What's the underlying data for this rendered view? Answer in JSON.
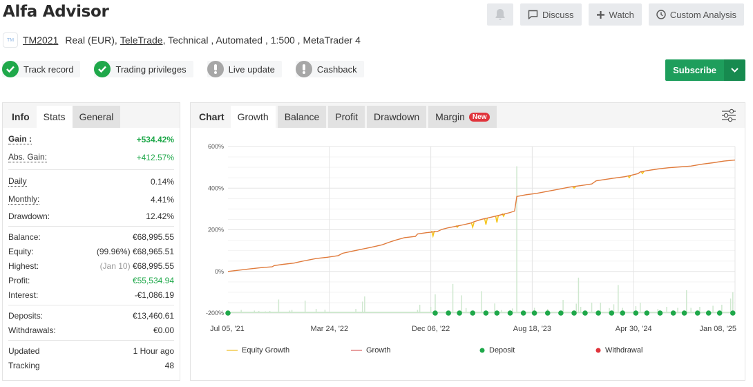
{
  "header": {
    "title": "Alfa Advisor",
    "actions": {
      "discuss": "Discuss",
      "watch": "Watch",
      "custom_analysis": "Custom Analysis"
    }
  },
  "account": {
    "logo_text": "TM",
    "name": "TM2021",
    "type": "Real (EUR),",
    "broker": "TeleTrade",
    "details": ", Technical , Automated , 1:500 , MetaTrader 4"
  },
  "badges": [
    {
      "label": "Track record",
      "status": "ok"
    },
    {
      "label": "Trading privileges",
      "status": "ok"
    },
    {
      "label": "Live update",
      "status": "warning"
    },
    {
      "label": "Cashback",
      "status": "warning"
    }
  ],
  "subscribe": {
    "label": "Subscribe"
  },
  "left_panel": {
    "tabs": [
      "Info",
      "Stats",
      "General"
    ],
    "stats": {
      "gain": {
        "label": "Gain :",
        "value": "+534.42%"
      },
      "abs_gain": {
        "label": "Abs. Gain:",
        "value": "+412.57%"
      },
      "daily": {
        "label": "Daily",
        "value": "0.14%"
      },
      "monthly": {
        "label": "Monthly:",
        "value": "4.41%"
      },
      "drawdown": {
        "label": "Drawdown:",
        "value": "12.42%"
      },
      "balance": {
        "label": "Balance:",
        "value": "€68,995.55"
      },
      "equity": {
        "label": "Equity:",
        "note": "(99.96%)",
        "value": "€68,965.51"
      },
      "highest": {
        "label": "Highest:",
        "note": "(Jan 10)",
        "value": "€68,995.55"
      },
      "profit": {
        "label": "Profit:",
        "value": "€55,534.94"
      },
      "interest": {
        "label": "Interest:",
        "value": "-€1,086.19"
      },
      "deposits": {
        "label": "Deposits:",
        "value": "€13,460.61"
      },
      "withdrawals": {
        "label": "Withdrawals:",
        "value": "€0.00"
      },
      "updated": {
        "label": "Updated",
        "value": "1 Hour ago"
      },
      "tracking": {
        "label": "Tracking",
        "value": "48"
      }
    }
  },
  "chart_panel": {
    "tabs": [
      "Chart",
      "Growth",
      "Balance",
      "Profit",
      "Drawdown",
      "Margin"
    ],
    "new_badge": "New"
  },
  "colors": {
    "growth": "#e07b3c",
    "equity_growth": "#f5c518",
    "deposit": "#1fa84a",
    "withdrawal": "#e0343c",
    "volume_bars": "#cfe8cf"
  },
  "chart_data": {
    "type": "line",
    "title": "",
    "xlabel": "",
    "ylabel": "",
    "ylim": [
      -200,
      600
    ],
    "yticks": [
      "600%",
      "400%",
      "200%",
      "0%",
      "-200%"
    ],
    "ytick_values": [
      600,
      400,
      200,
      0,
      -200
    ],
    "xticks": [
      "Jul 05, '21",
      "Mar 24, '22",
      "Dec 06, '22",
      "Aug 18, '23",
      "Apr 30, '24",
      "Jan 08, '25"
    ],
    "x_range": [
      0,
      1
    ],
    "grid": true,
    "legend_position": "bottom",
    "legend": [
      "Equity Growth",
      "Growth",
      "Deposit",
      "Withdrawal"
    ],
    "series": [
      {
        "name": "Growth",
        "points": [
          [
            0,
            0
          ],
          [
            0.05,
            6
          ],
          [
            0.1,
            12
          ],
          [
            0.15,
            18
          ],
          [
            0.2,
            22
          ],
          [
            0.21,
            28
          ],
          [
            0.25,
            34
          ],
          [
            0.3,
            40
          ],
          [
            0.32,
            45
          ],
          [
            0.36,
            54
          ],
          [
            0.4,
            62
          ],
          [
            0.45,
            68
          ],
          [
            0.5,
            76
          ],
          [
            0.52,
            87
          ],
          [
            0.55,
            94
          ],
          [
            0.6,
            105
          ],
          [
            0.65,
            116
          ],
          [
            0.7,
            128
          ],
          [
            0.73,
            140
          ],
          [
            0.76,
            150
          ],
          [
            0.8,
            162
          ],
          [
            0.85,
            168
          ],
          [
            0.86,
            180
          ],
          [
            0.9,
            186
          ],
          [
            0.95,
            192
          ],
          [
            0.97,
            202
          ],
          [
            1.0,
            210
          ],
          [
            1.05,
            220
          ],
          [
            1.1,
            232
          ],
          [
            1.12,
            240
          ],
          [
            1.15,
            250
          ],
          [
            1.2,
            262
          ],
          [
            1.25,
            275
          ],
          [
            1.28,
            283
          ],
          [
            1.3,
            290
          ],
          [
            1.31,
            360
          ],
          [
            1.35,
            368
          ],
          [
            1.4,
            375
          ],
          [
            1.45,
            385
          ],
          [
            1.5,
            395
          ],
          [
            1.55,
            405
          ],
          [
            1.6,
            412
          ],
          [
            1.65,
            420
          ],
          [
            1.67,
            435
          ],
          [
            1.7,
            440
          ],
          [
            1.75,
            448
          ],
          [
            1.8,
            455
          ],
          [
            1.83,
            462
          ],
          [
            1.86,
            470
          ],
          [
            1.87,
            478
          ],
          [
            1.9,
            484
          ],
          [
            1.95,
            492
          ],
          [
            2.0,
            498
          ],
          [
            2.05,
            502
          ],
          [
            2.1,
            506
          ],
          [
            2.15,
            515
          ],
          [
            2.2,
            522
          ],
          [
            2.25,
            530
          ],
          [
            2.3,
            535
          ]
        ]
      },
      {
        "name": "Equity Growth",
        "dips": [
          [
            0.93,
            195,
            170
          ],
          [
            1.04,
            220,
            212
          ],
          [
            1.11,
            235,
            212
          ],
          [
            1.17,
            255,
            225
          ],
          [
            1.22,
            268,
            235
          ],
          [
            1.25,
            278,
            265
          ],
          [
            1.57,
            406,
            400
          ],
          [
            1.82,
            460,
            450
          ],
          [
            1.88,
            480,
            470
          ]
        ]
      },
      {
        "name": "Deposit",
        "x": [
          0,
          0.94,
          1.0,
          1.05,
          1.11,
          1.17,
          1.22,
          1.28,
          1.34,
          1.39,
          1.45,
          1.51,
          1.57,
          1.62,
          1.68,
          1.74,
          1.79,
          1.85,
          1.9,
          1.96,
          2.02,
          2.07,
          2.13,
          2.18,
          2.23,
          2.29
        ],
        "y": -200
      },
      {
        "name": "Withdrawal",
        "x": []
      }
    ],
    "x_max": 2.3,
    "volume_bars": [
      [
        0.06,
        -185
      ],
      [
        0.12,
        -188
      ],
      [
        0.14,
        -190
      ],
      [
        0.17,
        -192
      ],
      [
        0.19,
        -190
      ],
      [
        0.23,
        -135
      ],
      [
        0.28,
        -188
      ],
      [
        0.29,
        -185
      ],
      [
        0.35,
        -140
      ],
      [
        0.4,
        -180
      ],
      [
        0.44,
        -184
      ],
      [
        0.58,
        -180
      ],
      [
        0.61,
        -145
      ],
      [
        0.62,
        -120
      ],
      [
        0.86,
        -185
      ],
      [
        0.87,
        -160
      ],
      [
        0.92,
        -170
      ],
      [
        0.94,
        -110
      ],
      [
        1.02,
        -60
      ],
      [
        1.06,
        -115
      ],
      [
        1.08,
        -176
      ],
      [
        1.15,
        -95
      ],
      [
        1.21,
        -154
      ],
      [
        1.24,
        -186
      ],
      [
        1.29,
        -178
      ],
      [
        1.31,
        505
      ],
      [
        1.39,
        -175
      ],
      [
        1.45,
        -180
      ],
      [
        1.52,
        -137
      ],
      [
        1.58,
        -155
      ],
      [
        1.59,
        -30
      ],
      [
        1.6,
        -170
      ],
      [
        1.65,
        -150
      ],
      [
        1.69,
        -150
      ],
      [
        1.73,
        -176
      ],
      [
        1.75,
        -158
      ],
      [
        1.77,
        -65
      ],
      [
        1.79,
        -175
      ],
      [
        1.85,
        -167
      ],
      [
        1.87,
        -150
      ],
      [
        1.95,
        -180
      ],
      [
        1.99,
        -170
      ],
      [
        2.04,
        -175
      ],
      [
        2.08,
        -90
      ],
      [
        2.1,
        -175
      ],
      [
        2.14,
        -170
      ],
      [
        2.2,
        -165
      ],
      [
        2.24,
        -160
      ],
      [
        2.28,
        -130
      ],
      [
        2.29,
        -100
      ]
    ]
  }
}
